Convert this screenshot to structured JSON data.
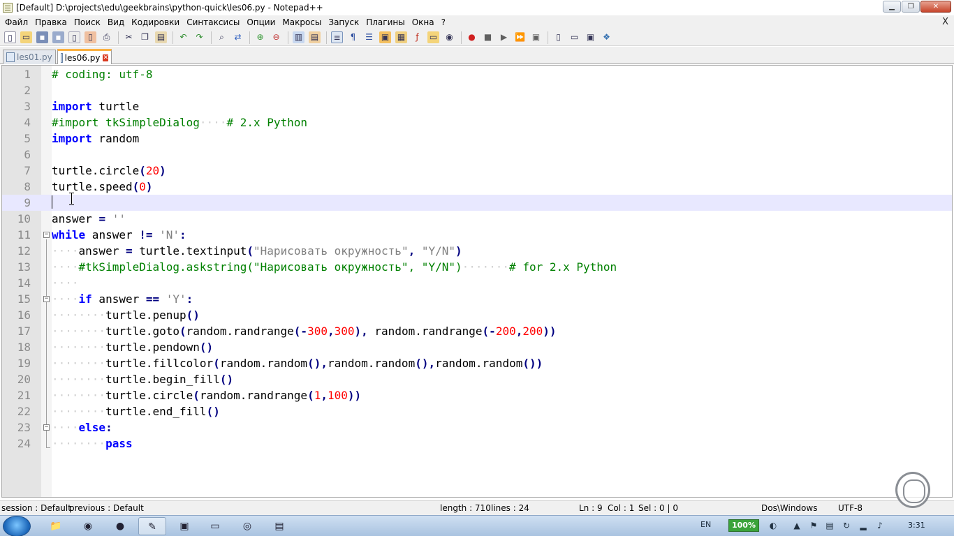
{
  "window": {
    "title": "[Default] D:\\projects\\edu\\geekbrains\\python-quick\\les06.py - Notepad++",
    "minimize": "▁",
    "maximize": "❐",
    "close": "✕"
  },
  "menu": {
    "items": [
      "Файл",
      "Правка",
      "Поиск",
      "Вид",
      "Кодировки",
      "Синтаксисы",
      "Опции",
      "Макросы",
      "Запуск",
      "Плагины",
      "Окна",
      "?"
    ],
    "close_doc": "X"
  },
  "toolbar": {
    "icons": [
      "new-icon",
      "open-icon",
      "save-icon",
      "save-all-icon",
      "close-icon",
      "close-all-icon",
      "print-icon",
      "cut-icon",
      "copy-icon",
      "paste-icon",
      "undo-icon",
      "redo-icon",
      "find-icon",
      "replace-icon",
      "zoom-in-icon",
      "zoom-out-icon",
      "sync-v-icon",
      "sync-h-icon",
      "wrap-icon",
      "all-chars-icon",
      "indent-guide-icon",
      "udl-icon",
      "doc-map-icon",
      "function-list-icon",
      "folder-workspace-icon",
      "monitor-icon",
      "record-macro-icon",
      "stop-macro-icon",
      "play-macro-icon",
      "run-macro-multi-icon",
      "save-macro-icon",
      "view-1-icon",
      "view-2-icon",
      "view-3-icon",
      "python-icon"
    ]
  },
  "tabs": [
    {
      "label": "les01.py",
      "active": false
    },
    {
      "label": "les06.py",
      "active": true
    }
  ],
  "editor": {
    "current_line": 9,
    "lines": [
      {
        "n": "1",
        "tokens": [
          {
            "t": "# coding: utf-8",
            "c": "cm"
          }
        ]
      },
      {
        "n": "2",
        "tokens": []
      },
      {
        "n": "3",
        "tokens": [
          {
            "t": "import",
            "c": "kw"
          },
          {
            "t": " turtle",
            "c": ""
          }
        ]
      },
      {
        "n": "4",
        "tokens": [
          {
            "t": "#import tkSimpleDialog",
            "c": "cm"
          },
          {
            "t": "····",
            "c": "ws"
          },
          {
            "t": "# 2.x Python",
            "c": "cm"
          }
        ]
      },
      {
        "n": "5",
        "tokens": [
          {
            "t": "import",
            "c": "kw"
          },
          {
            "t": " random",
            "c": ""
          }
        ]
      },
      {
        "n": "6",
        "tokens": []
      },
      {
        "n": "7",
        "tokens": [
          {
            "t": "turtle.circle",
            "c": ""
          },
          {
            "t": "(",
            "c": "op"
          },
          {
            "t": "20",
            "c": "num"
          },
          {
            "t": ")",
            "c": "op"
          }
        ]
      },
      {
        "n": "8",
        "tokens": [
          {
            "t": "turtle.speed",
            "c": ""
          },
          {
            "t": "(",
            "c": "op"
          },
          {
            "t": "0",
            "c": "num"
          },
          {
            "t": ")",
            "c": "op"
          }
        ]
      },
      {
        "n": "9",
        "tokens": []
      },
      {
        "n": "10",
        "tokens": [
          {
            "t": "answer ",
            "c": ""
          },
          {
            "t": "=",
            "c": "op"
          },
          {
            "t": " ''",
            "c": "str"
          }
        ]
      },
      {
        "n": "11",
        "tokens": [
          {
            "t": "while",
            "c": "kw"
          },
          {
            "t": " answer ",
            "c": ""
          },
          {
            "t": "!=",
            "c": "op"
          },
          {
            "t": " 'N'",
            "c": "str"
          },
          {
            "t": ":",
            "c": "op"
          }
        ]
      },
      {
        "n": "12",
        "tokens": [
          {
            "t": "····",
            "c": "ws"
          },
          {
            "t": "answer ",
            "c": ""
          },
          {
            "t": "=",
            "c": "op"
          },
          {
            "t": " turtle.textinput",
            "c": ""
          },
          {
            "t": "(",
            "c": "op"
          },
          {
            "t": "\"Нарисовать окружность\"",
            "c": "str"
          },
          {
            "t": ", ",
            "c": "op"
          },
          {
            "t": "\"Y/N\"",
            "c": "str"
          },
          {
            "t": ")",
            "c": "op"
          }
        ]
      },
      {
        "n": "13",
        "tokens": [
          {
            "t": "····",
            "c": "ws"
          },
          {
            "t": "#tkSimpleDialog.askstring(\"Нарисовать окружность\", \"Y/N\")",
            "c": "cm"
          },
          {
            "t": "·······",
            "c": "ws"
          },
          {
            "t": "# for 2.x Python",
            "c": "cm"
          }
        ]
      },
      {
        "n": "14",
        "tokens": [
          {
            "t": "····",
            "c": "ws"
          }
        ]
      },
      {
        "n": "15",
        "tokens": [
          {
            "t": "····",
            "c": "ws"
          },
          {
            "t": "if",
            "c": "kw"
          },
          {
            "t": " answer ",
            "c": ""
          },
          {
            "t": "==",
            "c": "op"
          },
          {
            "t": " 'Y'",
            "c": "str"
          },
          {
            "t": ":",
            "c": "op"
          }
        ]
      },
      {
        "n": "16",
        "tokens": [
          {
            "t": "········",
            "c": "ws"
          },
          {
            "t": "turtle.penup",
            "c": ""
          },
          {
            "t": "()",
            "c": "op"
          }
        ]
      },
      {
        "n": "17",
        "tokens": [
          {
            "t": "········",
            "c": "ws"
          },
          {
            "t": "turtle.goto",
            "c": ""
          },
          {
            "t": "(",
            "c": "op"
          },
          {
            "t": "random.randrange",
            "c": ""
          },
          {
            "t": "(-",
            "c": "op"
          },
          {
            "t": "300",
            "c": "num"
          },
          {
            "t": ",",
            "c": "op"
          },
          {
            "t": "300",
            "c": "num"
          },
          {
            "t": "),",
            "c": "op"
          },
          {
            "t": " random.randrange",
            "c": ""
          },
          {
            "t": "(-",
            "c": "op"
          },
          {
            "t": "200",
            "c": "num"
          },
          {
            "t": ",",
            "c": "op"
          },
          {
            "t": "200",
            "c": "num"
          },
          {
            "t": "))",
            "c": "op"
          }
        ]
      },
      {
        "n": "18",
        "tokens": [
          {
            "t": "········",
            "c": "ws"
          },
          {
            "t": "turtle.pendown",
            "c": ""
          },
          {
            "t": "()",
            "c": "op"
          }
        ]
      },
      {
        "n": "19",
        "tokens": [
          {
            "t": "········",
            "c": "ws"
          },
          {
            "t": "turtle.fillcolor",
            "c": ""
          },
          {
            "t": "(",
            "c": "op"
          },
          {
            "t": "random.random",
            "c": ""
          },
          {
            "t": "(),",
            "c": "op"
          },
          {
            "t": "random.random",
            "c": ""
          },
          {
            "t": "(),",
            "c": "op"
          },
          {
            "t": "random.random",
            "c": ""
          },
          {
            "t": "())",
            "c": "op"
          }
        ]
      },
      {
        "n": "20",
        "tokens": [
          {
            "t": "········",
            "c": "ws"
          },
          {
            "t": "turtle.begin_fill",
            "c": ""
          },
          {
            "t": "()",
            "c": "op"
          }
        ]
      },
      {
        "n": "21",
        "tokens": [
          {
            "t": "········",
            "c": "ws"
          },
          {
            "t": "turtle.circle",
            "c": ""
          },
          {
            "t": "(",
            "c": "op"
          },
          {
            "t": "random.randrange",
            "c": ""
          },
          {
            "t": "(",
            "c": "op"
          },
          {
            "t": "1",
            "c": "num"
          },
          {
            "t": ",",
            "c": "op"
          },
          {
            "t": "100",
            "c": "num"
          },
          {
            "t": "))",
            "c": "op"
          }
        ]
      },
      {
        "n": "22",
        "tokens": [
          {
            "t": "········",
            "c": "ws"
          },
          {
            "t": "turtle.end_fill",
            "c": ""
          },
          {
            "t": "()",
            "c": "op"
          }
        ]
      },
      {
        "n": "23",
        "tokens": [
          {
            "t": "····",
            "c": "ws"
          },
          {
            "t": "else",
            "c": "kw"
          },
          {
            "t": ":",
            "c": "op"
          }
        ]
      },
      {
        "n": "24",
        "tokens": [
          {
            "t": "········",
            "c": "ws"
          },
          {
            "t": "pass",
            "c": "kw"
          }
        ]
      }
    ]
  },
  "status": {
    "session": "session : Default",
    "previous": "previous : Default",
    "length": "length : 710",
    "lines": "lines : 24",
    "ln": "Ln : 9",
    "col": "Col : 1",
    "sel": "Sel : 0 | 0",
    "eol": "Dos\\Windows",
    "encoding": "UTF-8"
  },
  "taskbar": {
    "apps": [
      {
        "name": "explorer",
        "glyph": "📁",
        "active": false
      },
      {
        "name": "chrome",
        "glyph": "◉",
        "active": false
      },
      {
        "name": "firefox",
        "glyph": "●",
        "active": false
      },
      {
        "name": "notepad-plus-plus",
        "glyph": "✎",
        "active": true
      },
      {
        "name": "pdf-viewer",
        "glyph": "▣",
        "active": false
      },
      {
        "name": "cmd",
        "glyph": "▭",
        "active": false
      },
      {
        "name": "presentation",
        "glyph": "◎",
        "active": false
      },
      {
        "name": "remote",
        "glyph": "▤",
        "active": false
      }
    ],
    "lang": "EN",
    "battery": "100%",
    "clock": "3:31"
  }
}
